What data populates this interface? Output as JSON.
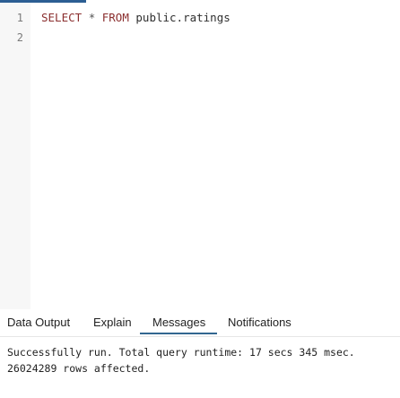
{
  "editor": {
    "line_numbers": [
      "1",
      "2"
    ],
    "line1": {
      "kw1": "SELECT",
      "star": "*",
      "kw2": "FROM",
      "table": "public.ratings"
    }
  },
  "tabs": [
    {
      "label": "Data Output"
    },
    {
      "label": "Explain"
    },
    {
      "label": "Messages",
      "active": true
    },
    {
      "label": "Notifications"
    }
  ],
  "messages": {
    "line1": "Successfully run. Total query runtime: 17 secs 345 msec.",
    "line2": "26024289 rows affected."
  },
  "colors": {
    "accent": "#326690",
    "keyword": "#8b2f2f"
  }
}
